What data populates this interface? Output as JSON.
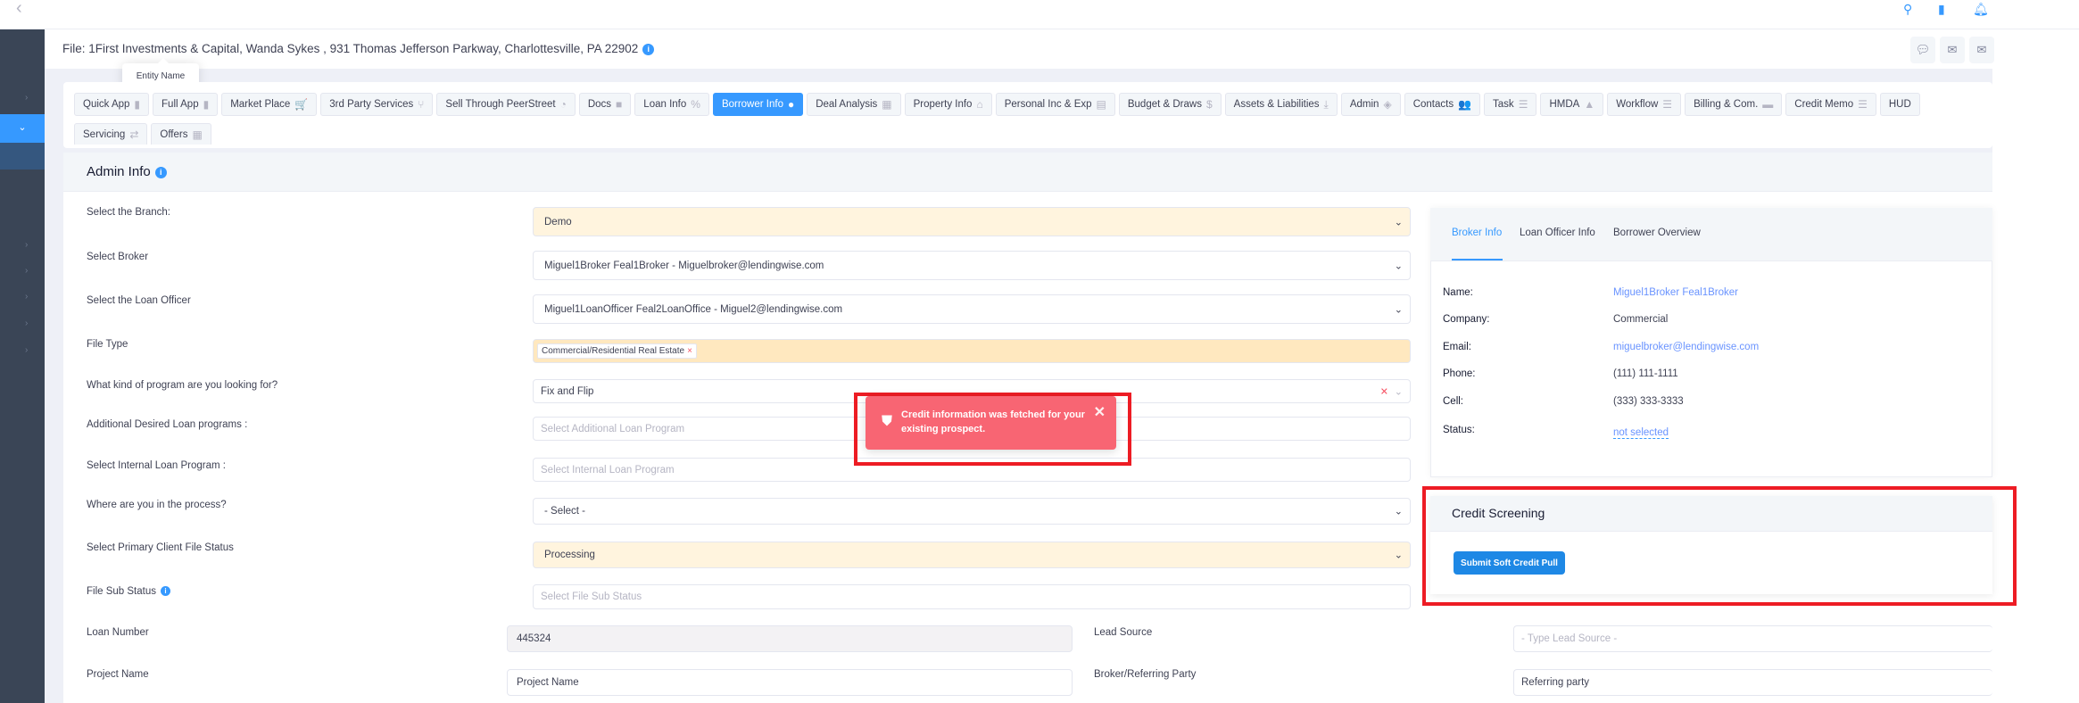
{
  "topbar": {
    "back_icon": "chevron-left-icon",
    "icons": [
      "search-icon",
      "document-icon",
      "bell-icon"
    ]
  },
  "sidebar": {
    "active_chevron": "⌄",
    "chevron": "›"
  },
  "file_header": {
    "title": "File: 1First Investments & Capital, Wanda Sykes , 931 Thomas Jefferson Parkway, Charlottesville, PA 22902",
    "tooltip": "Entity Name",
    "actions": [
      "chat-icon",
      "mail-icon",
      "mail-open-icon"
    ]
  },
  "tabs": [
    {
      "label": "Quick App",
      "icon": "▮"
    },
    {
      "label": "Full App",
      "icon": "▮"
    },
    {
      "label": "Market Place",
      "icon": "🛒"
    },
    {
      "label": "3rd Party Services",
      "icon": "⑂"
    },
    {
      "label": "Sell Through PeerStreet",
      "icon": "◔"
    },
    {
      "label": "Docs",
      "icon": "■"
    },
    {
      "label": "Loan Info",
      "icon": "%"
    },
    {
      "label": "Borrower Info",
      "icon": "●"
    },
    {
      "label": "Deal Analysis",
      "icon": "▦"
    },
    {
      "label": "Property Info",
      "icon": "⌂"
    },
    {
      "label": "Personal Inc & Exp",
      "icon": "▤"
    },
    {
      "label": "Budget & Draws",
      "icon": "$"
    },
    {
      "label": "Assets & Liabilities",
      "icon": "⤓"
    },
    {
      "label": "Admin",
      "icon": "◈"
    },
    {
      "label": "Contacts",
      "icon": "👥"
    },
    {
      "label": "Task",
      "icon": "☰"
    },
    {
      "label": "HMDA",
      "icon": "▲"
    },
    {
      "label": "Workflow",
      "icon": "☰"
    },
    {
      "label": "Billing & Com.",
      "icon": "▬"
    },
    {
      "label": "Credit Memo",
      "icon": "☰"
    },
    {
      "label": "HUD",
      "icon": ""
    },
    {
      "label": "Servicing",
      "icon": "⇄"
    },
    {
      "label": "Offers",
      "icon": "▦"
    }
  ],
  "admin_info": {
    "title": "Admin Info",
    "fields": [
      {
        "label": "Select the Branch:",
        "value": "Demo"
      },
      {
        "label": "Select Broker",
        "value": "Miguel1Broker Feal1Broker - Miguelbroker@lendingwise.com"
      },
      {
        "label": "Select the Loan Officer",
        "value": "Miguel1LoanOfficer Feal2LoanOffice - Miguel2@lendingwise.com"
      },
      {
        "label": "File Type",
        "value": "Commercial/Residential Real Estate"
      },
      {
        "label": "What kind of program are you looking for?",
        "value": "Fix and Flip"
      },
      {
        "label": "Additional Desired Loan programs :",
        "placeholder": "Select Additional Loan Program"
      },
      {
        "label": "Select Internal Loan Program :",
        "placeholder": "Select Internal Loan Program"
      },
      {
        "label": "Where are you in the process?",
        "value": "- Select -"
      },
      {
        "label": "Select Primary Client File Status",
        "value": "Processing"
      },
      {
        "label": "File Sub Status",
        "placeholder": "Select File Sub Status"
      },
      {
        "label": "Loan Number",
        "value": "445324"
      },
      {
        "label": "Project Name",
        "placeholder": "Project Name"
      },
      {
        "label": "Lead Source",
        "placeholder": "- Type Lead Source -"
      },
      {
        "label": "Broker/Referring Party",
        "value": "Referring party"
      }
    ]
  },
  "right_panel": {
    "tabs": [
      "Broker Info",
      "Loan Officer Info",
      "Borrower Overview"
    ],
    "rows": [
      {
        "label": "Name:",
        "value": "Miguel1Broker Feal1Broker"
      },
      {
        "label": "Company:",
        "value": "Commercial"
      },
      {
        "label": "Email:",
        "value": "miguelbroker@lendingwise.com"
      },
      {
        "label": "Phone:",
        "value": "(111) 111-1111"
      },
      {
        "label": "Cell:",
        "value": "(333) 333-3333"
      },
      {
        "label": "Status:",
        "value": "not selected"
      }
    ]
  },
  "credit_screening": {
    "title": "Credit Screening",
    "button": "Submit Soft Credit Pull"
  },
  "toast": {
    "message": "Credit information was fetched for your existing prospect.",
    "close": "✕",
    "icon": "shield-alert-icon"
  },
  "colors": {
    "accent": "#3699ff",
    "sidebar": "#3a4556",
    "toast": "#f86573",
    "highlight": "#ed1c24"
  }
}
